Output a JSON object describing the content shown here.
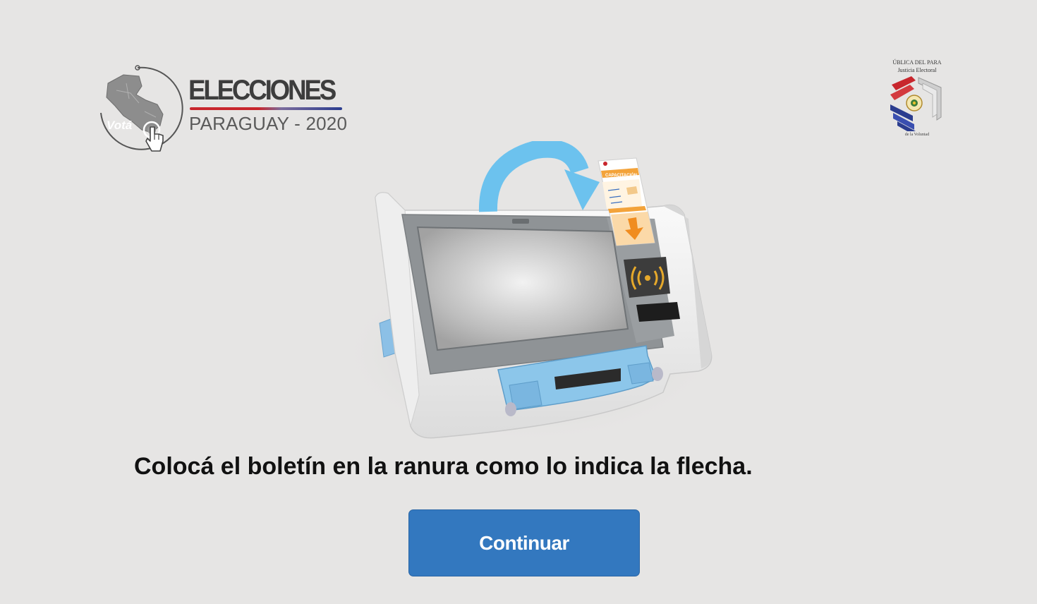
{
  "header": {
    "brand_title": "ELECCIONES",
    "brand_subtitle": "PARAGUAY - 2020",
    "vota_label": "Votá",
    "seal_top": "ÚBLICA DEL PARA",
    "seal_sub": "Justicia Electoral",
    "seal_bottom": "de la Voluntad"
  },
  "illustration": {
    "ballot_header": "CAPACITACIÓN",
    "nfc_icon": "nfc-signal-icon",
    "arrow_icon": "curved-arrow-icon"
  },
  "main": {
    "instruction": "Colocá el boletín en la ranura como lo indica la flecha.",
    "continue_label": "Continuar"
  },
  "colors": {
    "background": "#e6e5e4",
    "button": "#3378bf",
    "arrow": "#6cc2ee",
    "nfc": "#e6a92b",
    "flag_red": "#c8262d",
    "flag_blue": "#2b3d8f"
  }
}
